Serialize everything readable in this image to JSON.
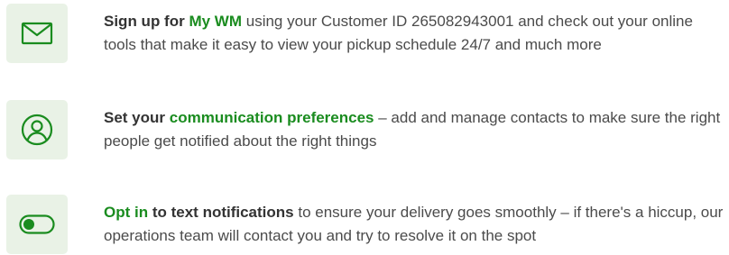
{
  "colors": {
    "accent_green": "#1a8c1f",
    "tile_background": "#e9f2e6",
    "body_text": "#4b4b4b"
  },
  "items": [
    {
      "icon": "envelope-icon",
      "bold_lead": "Sign up for",
      "link": "My WM",
      "body": "using your Customer ID 265082943001 and check out your online tools that make it easy to view your pickup schedule 24/7 and much more"
    },
    {
      "icon": "user-circle-icon",
      "bold_lead": "Set your",
      "link": "communication preferences",
      "body": "– add and manage contacts to make sure the right people get notified about the right things"
    },
    {
      "icon": "toggle-switch-icon",
      "link": "Opt in",
      "bold_tail": "to text notifications",
      "body": "to ensure your delivery goes smoothly – if there's a hiccup, our operations team will contact you and try to resolve it on the spot"
    }
  ]
}
